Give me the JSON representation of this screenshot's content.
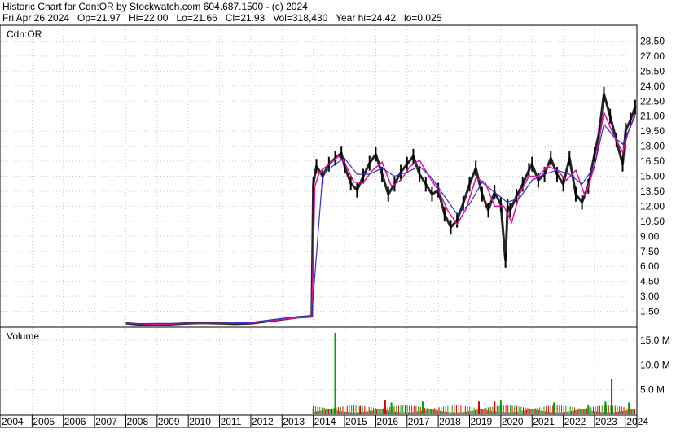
{
  "header": {
    "line1": "Historic Chart for Cdn:OR by Stockwatch.com 604.687.1500 - (c) 2024",
    "line2": "Fri Apr 26 2024   Op=21.97   Hi=22.00   Lo=21.66   Cl=21.93   Vol=318,430   Year hi=24.42   lo=0.025"
  },
  "price_panel": {
    "label": "Cdn:OR"
  },
  "volume_panel": {
    "label": "Volume"
  },
  "chart_data": [
    {
      "type": "line",
      "panel": "price",
      "title": "Cdn:OR",
      "x_unit": "year",
      "xlim": [
        2004,
        2024.33
      ],
      "ylim": [
        0,
        30
      ],
      "y_ticks": [
        "28.50",
        "27.00",
        "25.50",
        "24.00",
        "22.50",
        "21.00",
        "19.50",
        "18.00",
        "16.50",
        "15.00",
        "13.50",
        "12.00",
        "10.50",
        "9.00",
        "7.50",
        "6.00",
        "4.50",
        "3.00",
        "1.50"
      ],
      "y_tick_values": [
        28.5,
        27,
        25.5,
        24,
        22.5,
        21,
        19.5,
        18,
        16.5,
        15,
        13.5,
        12,
        10.5,
        9,
        7.5,
        6,
        4.5,
        3,
        1.5
      ],
      "grid": true,
      "colors": {
        "price": "#000000",
        "ma_short": "#e0109a",
        "ma_long": "#3030d0"
      },
      "series": [
        {
          "style": "price",
          "x": [
            2008.0,
            2008.4,
            2008.9,
            2009.4,
            2010.0,
            2010.5,
            2011.0,
            2011.5,
            2012.0,
            2012.5,
            2013.0,
            2013.5,
            2013.95,
            2014.0,
            2014.1,
            2014.3,
            2014.5,
            2014.7,
            2014.9,
            2015.0,
            2015.2,
            2015.4,
            2015.6,
            2015.8,
            2016.0,
            2016.2,
            2016.4,
            2016.6,
            2016.8,
            2017.0,
            2017.2,
            2017.4,
            2017.6,
            2017.8,
            2018.0,
            2018.2,
            2018.4,
            2018.6,
            2018.8,
            2019.0,
            2019.2,
            2019.4,
            2019.6,
            2019.8,
            2020.0,
            2020.15,
            2020.22,
            2020.3,
            2020.5,
            2020.7,
            2020.9,
            2021.0,
            2021.2,
            2021.4,
            2021.6,
            2021.8,
            2022.0,
            2022.2,
            2022.4,
            2022.6,
            2022.8,
            2023.0,
            2023.15,
            2023.3,
            2023.5,
            2023.7,
            2023.9,
            2024.0,
            2024.15,
            2024.3
          ],
          "y": [
            0.3,
            0.2,
            0.2,
            0.2,
            0.3,
            0.35,
            0.3,
            0.25,
            0.3,
            0.5,
            0.7,
            0.9,
            1.0,
            14.2,
            16.0,
            15.0,
            16.2,
            16.8,
            17.3,
            16.0,
            14.3,
            13.6,
            15.0,
            16.3,
            17.2,
            15.2,
            13.2,
            14.2,
            15.4,
            16.2,
            17.0,
            15.2,
            14.2,
            13.2,
            13.6,
            11.2,
            9.9,
            10.6,
            12.3,
            14.2,
            15.8,
            13.2,
            11.6,
            13.4,
            12.2,
            6.6,
            12.0,
            11.6,
            13.0,
            14.2,
            15.6,
            16.2,
            14.6,
            15.2,
            16.8,
            15.2,
            14.2,
            16.8,
            13.2,
            12.4,
            14.0,
            17.2,
            19.4,
            23.2,
            21.0,
            18.6,
            16.2,
            19.6,
            20.6,
            21.9
          ]
        },
        {
          "style": "ma_short",
          "x": [
            2008.0,
            2009.0,
            2010.0,
            2011.0,
            2012.0,
            2013.0,
            2013.95,
            2014.05,
            2014.2,
            2014.5,
            2014.8,
            2015.0,
            2015.3,
            2015.6,
            2015.9,
            2016.2,
            2016.5,
            2016.8,
            2017.1,
            2017.4,
            2017.7,
            2018.0,
            2018.3,
            2018.6,
            2018.9,
            2019.2,
            2019.5,
            2019.8,
            2020.1,
            2020.35,
            2020.6,
            2020.9,
            2021.2,
            2021.5,
            2021.8,
            2022.1,
            2022.4,
            2022.7,
            2023.0,
            2023.3,
            2023.6,
            2023.9,
            2024.1,
            2024.3
          ],
          "y": [
            0.3,
            0.2,
            0.3,
            0.3,
            0.35,
            0.7,
            1.0,
            14.0,
            15.4,
            16.2,
            17.0,
            16.4,
            14.4,
            14.4,
            15.6,
            16.4,
            14.0,
            14.6,
            16.0,
            16.6,
            15.0,
            13.6,
            11.6,
            10.2,
            11.8,
            14.8,
            14.4,
            12.0,
            12.0,
            10.4,
            13.2,
            15.0,
            15.0,
            16.0,
            15.6,
            14.6,
            15.6,
            13.0,
            16.0,
            21.4,
            19.2,
            17.4,
            19.6,
            21.2
          ]
        },
        {
          "style": "ma_long",
          "x": [
            2008.0,
            2009.0,
            2010.0,
            2011.0,
            2012.0,
            2013.0,
            2013.95,
            2014.3,
            2014.7,
            2015.0,
            2015.4,
            2015.8,
            2016.2,
            2016.6,
            2017.0,
            2017.4,
            2017.8,
            2018.2,
            2018.6,
            2019.0,
            2019.4,
            2019.8,
            2020.2,
            2020.6,
            2021.0,
            2021.4,
            2021.8,
            2022.2,
            2022.6,
            2023.0,
            2023.3,
            2023.6,
            2023.9,
            2024.3
          ],
          "y": [
            0.25,
            0.3,
            0.3,
            0.3,
            0.4,
            0.8,
            1.1,
            15.2,
            16.2,
            16.8,
            15.2,
            15.2,
            15.8,
            15.0,
            15.4,
            16.0,
            14.8,
            13.0,
            11.2,
            12.2,
            14.4,
            13.4,
            12.4,
            12.8,
            14.6,
            15.2,
            15.6,
            15.2,
            14.2,
            16.0,
            20.2,
            19.0,
            18.2,
            21.0
          ]
        }
      ]
    },
    {
      "type": "bar",
      "panel": "volume",
      "title": "Volume",
      "y_unit": "M shares",
      "ylim": [
        0,
        17.5
      ],
      "y_ticks": [
        "15.0 M",
        "10.0 M",
        "5.0 M"
      ],
      "y_tick_values": [
        15,
        10,
        5
      ],
      "grid": true,
      "colors": {
        "up": "#00a000",
        "down": "#e00000"
      },
      "bars": [
        {
          "x": 2014.0,
          "v": 1.2,
          "dir": "up"
        },
        {
          "x": 2014.7,
          "v": 16.5,
          "dir": "up"
        },
        {
          "x": 2015.5,
          "v": 1.6,
          "dir": "down"
        },
        {
          "x": 2016.3,
          "v": 2.8,
          "dir": "down"
        },
        {
          "x": 2016.5,
          "v": 2.4,
          "dir": "up"
        },
        {
          "x": 2017.5,
          "v": 2.6,
          "dir": "up"
        },
        {
          "x": 2019.3,
          "v": 2.6,
          "dir": "down"
        },
        {
          "x": 2019.8,
          "v": 2.6,
          "dir": "down"
        },
        {
          "x": 2020.0,
          "v": 2.8,
          "dir": "up"
        },
        {
          "x": 2021.7,
          "v": 2.4,
          "dir": "up"
        },
        {
          "x": 2022.8,
          "v": 2.0,
          "dir": "up"
        },
        {
          "x": 2023.35,
          "v": 2.6,
          "dir": "up"
        },
        {
          "x": 2023.55,
          "v": 7.2,
          "dir": "down"
        },
        {
          "x": 2024.1,
          "v": 2.4,
          "dir": "up"
        }
      ]
    },
    {
      "type": "axis",
      "panel": "x_axis",
      "categories": [
        "2004",
        "2005",
        "2006",
        "2007",
        "2008",
        "2009",
        "2010",
        "2011",
        "2012",
        "2013",
        "2014",
        "2015",
        "2016",
        "2017",
        "2018",
        "2019",
        "2020",
        "2021",
        "2022",
        "2023",
        "2024"
      ]
    }
  ]
}
